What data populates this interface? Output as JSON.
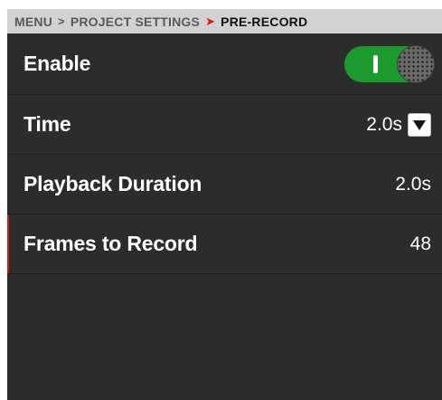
{
  "breadcrumb": {
    "items": [
      "MENU",
      "PROJECT SETTINGS"
    ],
    "current": "PRE-RECORD",
    "separator": ">",
    "active_separator": "➤"
  },
  "settings": {
    "enable": {
      "label": "Enable",
      "toggle_on": true
    },
    "time": {
      "label": "Time",
      "value": "2.0s"
    },
    "playback": {
      "label": "Playback Duration",
      "value": "2.0s"
    },
    "frames": {
      "label": "Frames to Record",
      "value": "48"
    }
  },
  "colors": {
    "accent_red": "#c8171d",
    "toggle_green": "#1d9a2e",
    "background": "#2c2c2c"
  },
  "icons": {
    "dropdown": "chevron-down-icon"
  }
}
